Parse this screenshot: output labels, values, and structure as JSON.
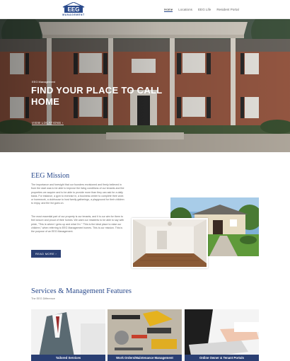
{
  "header": {
    "logo_sub": "MANAGEMENT",
    "nav": [
      {
        "label": "Home"
      },
      {
        "label": "Locations"
      },
      {
        "label": "EEG Life"
      },
      {
        "label": "Resident Portal"
      }
    ]
  },
  "hero": {
    "kicker": "EEG Management",
    "title": "FIND YOUR PLACE TO CALL HOME",
    "link": "VIEW LOCATIONS ›"
  },
  "mission": {
    "title": "EEG Mission",
    "p1": "The importance and foresight that our founders envisioned and firmly believed in from the start was to be able to improve the living conditions of our tenants and the properties we acquire and to be able to provide more than they can ask for a daily basis. For instance, a gym to exercise in, a business center to complete their work or homework, a clubhouse to host family gatherings, a playground for their children to enjoy, and the list goes on.",
    "p2": "The most essential part of our property is our tenants, and it is our aim for them to feel secure and proud of their homes. We want our residents to be able to say with pride, “This is where I grew up and what I’m.” “This is the ideal place to raise our children,” when referring to EEG Management homes. This is our mission. This is the purpose of an EEG Management.",
    "read_more": "READ MORE ›"
  },
  "services": {
    "title": "Services & Management Features",
    "subtitle": "The EEG Difference",
    "cards": [
      {
        "label": "Tailored Services"
      },
      {
        "label": "Work Orders/Maintenance Management"
      },
      {
        "label": "Online Owner & Tenant Portals"
      }
    ]
  },
  "colors": {
    "brand_blue": "#2a4a8c",
    "button_navy": "#2a3f73"
  }
}
